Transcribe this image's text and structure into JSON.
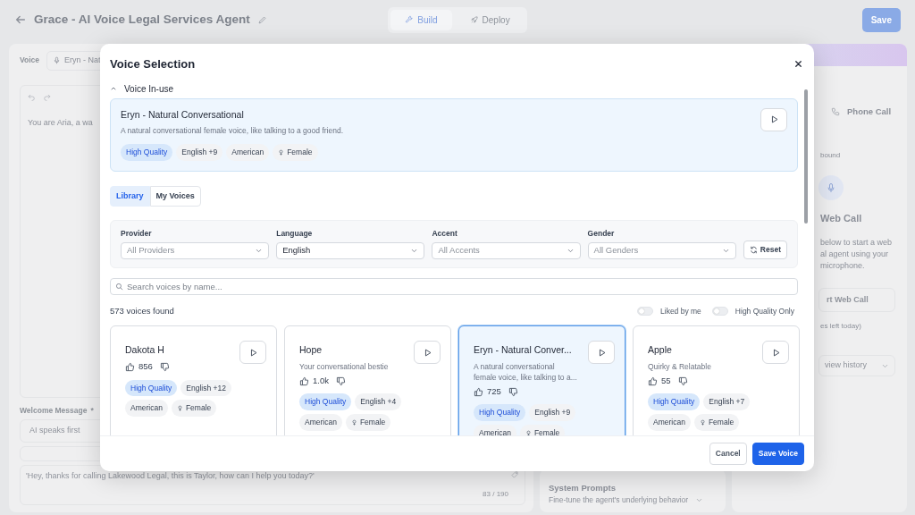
{
  "header": {
    "title": "Grace - AI Voice Legal Services Agent",
    "mode_tabs": [
      {
        "label": "Build",
        "selected": true
      },
      {
        "label": "Deploy",
        "selected": false
      }
    ],
    "save_button": "Save"
  },
  "left_panel": {
    "voice_label": "Voice",
    "voice_value": "Eryn - Nat",
    "prompt_text": "You are Aria, a wa",
    "welcome_label": "Welcome Message",
    "required_mark": "*",
    "welcome_mode": "AI speaks first",
    "welcome_text": "'Hey, thanks for calling Lakewood Legal, this is Taylor, how can I help you today?'",
    "char_count": "83 / 190"
  },
  "middle_panel": {
    "title": "System Prompts",
    "subtitle": "Fine-tune the agent's underlying behavior"
  },
  "right_panel": {
    "call_tab": "Phone Call",
    "direction_label": "bound",
    "heading": "Web Call",
    "description_lines": [
      "below to start a web",
      "al agent using your",
      "microphone."
    ],
    "start_button": "rt Web Call",
    "quota": "es left today)",
    "history_select": "view history"
  },
  "modal": {
    "title": "Voice Selection",
    "in_use": {
      "heading": "Voice In-use",
      "expanded": true,
      "name": "Eryn - Natural Conversational",
      "description": "A natural conversational female voice, like talking to a good friend.",
      "tags": [
        {
          "label": "High Quality",
          "kind": "quality"
        },
        {
          "label": "English +9",
          "kind": "plain"
        },
        {
          "label": "American",
          "kind": "plain"
        },
        {
          "label": "Female",
          "kind": "gender"
        }
      ]
    },
    "source_tabs": [
      {
        "label": "Library",
        "selected": true
      },
      {
        "label": "My Voices",
        "selected": false
      }
    ],
    "filters": [
      {
        "label": "Provider",
        "placeholder": "All Providers"
      },
      {
        "label": "Language",
        "value": "English"
      },
      {
        "label": "Accent",
        "placeholder": "All Accents"
      },
      {
        "label": "Gender",
        "placeholder": "All Genders"
      }
    ],
    "reset_button": "Reset",
    "search": {
      "placeholder": "Search voices by name..."
    },
    "count": "573 voices found",
    "toggles": [
      {
        "label": "Liked by me",
        "on": false
      },
      {
        "label": "High Quality Only",
        "on": false
      }
    ],
    "voices": [
      {
        "name": "Dakota H",
        "likes": "856",
        "selected": false,
        "tags": [
          {
            "label": "High Quality",
            "kind": "quality"
          },
          {
            "label": "English +12",
            "kind": "plain"
          },
          {
            "label": "American",
            "kind": "plain"
          },
          {
            "label": "Female",
            "kind": "gender"
          }
        ]
      },
      {
        "name": "Hope",
        "description": "Your conversational bestie",
        "likes": "1.0k",
        "selected": false,
        "tags": [
          {
            "label": "High Quality",
            "kind": "quality"
          },
          {
            "label": "English +4",
            "kind": "plain"
          },
          {
            "label": "American",
            "kind": "plain"
          },
          {
            "label": "Female",
            "kind": "gender"
          }
        ]
      },
      {
        "name": "Eryn - Natural Conver...",
        "description": "A natural conversational female voice, like talking to a...",
        "likes": "725",
        "selected": true,
        "tags": [
          {
            "label": "High Quality",
            "kind": "quality"
          },
          {
            "label": "English +9",
            "kind": "plain"
          },
          {
            "label": "American",
            "kind": "plain"
          },
          {
            "label": "Female",
            "kind": "gender"
          }
        ]
      },
      {
        "name": "Apple",
        "description": "Quirky & Relatable",
        "likes": "55",
        "selected": false,
        "tags": [
          {
            "label": "High Quality",
            "kind": "quality"
          },
          {
            "label": "English +7",
            "kind": "plain"
          },
          {
            "label": "American",
            "kind": "plain"
          },
          {
            "label": "Female",
            "kind": "gender"
          }
        ]
      }
    ],
    "buttons": [
      {
        "label": "Cancel",
        "kind": "secondary"
      },
      {
        "label": "Save Voice",
        "kind": "primary"
      }
    ]
  }
}
